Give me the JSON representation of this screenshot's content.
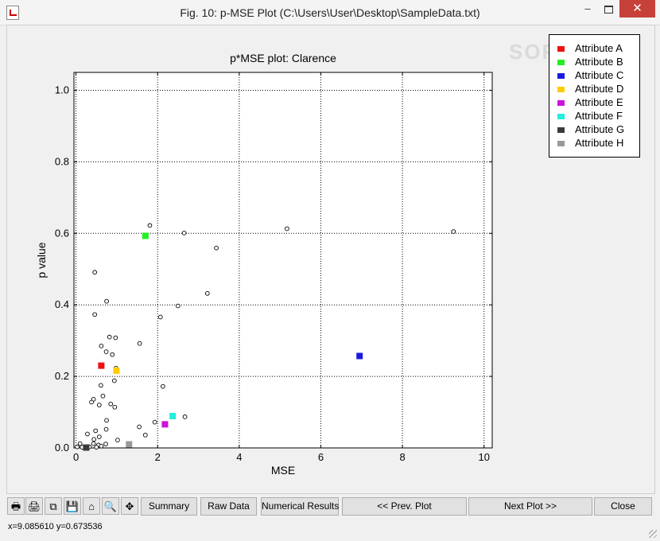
{
  "window": {
    "title": "Fig. 10: p-MSE Plot (C:\\Users\\User\\Desktop\\SampleData.txt)",
    "minimize": "–",
    "close": "✕"
  },
  "watermark": "SOFT",
  "legend": {
    "items": [
      {
        "label": "Attribute A",
        "color": "#ee1111"
      },
      {
        "label": "Attribute B",
        "color": "#22ee22"
      },
      {
        "label": "Attribute C",
        "color": "#1a1adf"
      },
      {
        "label": "Attribute D",
        "color": "#ffcc00"
      },
      {
        "label": "Attribute E",
        "color": "#cc11dd"
      },
      {
        "label": "Attribute F",
        "color": "#22eedd"
      },
      {
        "label": "Attribute G",
        "color": "#3a3a3a"
      },
      {
        "label": "Attribute H",
        "color": "#999999"
      }
    ]
  },
  "chart_data": {
    "type": "scatter",
    "title": "p*MSE plot: Clarence",
    "xlabel": "MSE",
    "ylabel": "p value",
    "xlim": [
      -0.05,
      10.2
    ],
    "ylim": [
      0,
      1.05
    ],
    "xticks": [
      "0",
      "2",
      "4",
      "6",
      "8",
      "10"
    ],
    "yticks": [
      "0.0",
      "0.2",
      "0.4",
      "0.6",
      "0.8",
      "1.0"
    ],
    "xtick_values": [
      0,
      2,
      4,
      6,
      8,
      10
    ],
    "ytick_values": [
      0,
      0.2,
      0.4,
      0.6,
      0.8,
      1.0
    ],
    "grid": true,
    "legend_position": "top-right",
    "highlighted": [
      {
        "name": "Attribute A",
        "x": 0.62,
        "y": 0.23,
        "color": "#ee1111"
      },
      {
        "name": "Attribute B",
        "x": 1.7,
        "y": 0.593,
        "color": "#22ee22"
      },
      {
        "name": "Attribute C",
        "x": 6.95,
        "y": 0.257,
        "color": "#1a1adf"
      },
      {
        "name": "Attribute D",
        "x": 0.99,
        "y": 0.216,
        "color": "#ffcc00"
      },
      {
        "name": "Attribute E",
        "x": 2.18,
        "y": 0.066,
        "color": "#cc11dd"
      },
      {
        "name": "Attribute F",
        "x": 2.37,
        "y": 0.089,
        "color": "#22eedd"
      },
      {
        "name": "Attribute G",
        "x": 0.25,
        "y": 0.001,
        "color": "#3a3a3a"
      },
      {
        "name": "Attribute H",
        "x": 1.3,
        "y": 0.01,
        "color": "#999999"
      }
    ],
    "points": [
      [
        1.81,
        0.622
      ],
      [
        2.65,
        0.601
      ],
      [
        5.17,
        0.613
      ],
      [
        9.25,
        0.605
      ],
      [
        3.44,
        0.559
      ],
      [
        0.46,
        0.491
      ],
      [
        3.22,
        0.432
      ],
      [
        0.75,
        0.41
      ],
      [
        2.5,
        0.397
      ],
      [
        0.46,
        0.373
      ],
      [
        2.07,
        0.366
      ],
      [
        0.82,
        0.31
      ],
      [
        0.97,
        0.308
      ],
      [
        1.56,
        0.292
      ],
      [
        0.62,
        0.285
      ],
      [
        0.74,
        0.269
      ],
      [
        0.89,
        0.261
      ],
      [
        0.98,
        0.223
      ],
      [
        0.94,
        0.188
      ],
      [
        2.13,
        0.172
      ],
      [
        0.61,
        0.175
      ],
      [
        0.66,
        0.145
      ],
      [
        0.43,
        0.136
      ],
      [
        0.38,
        0.128
      ],
      [
        0.57,
        0.12
      ],
      [
        0.85,
        0.123
      ],
      [
        0.95,
        0.114
      ],
      [
        0.75,
        0.077
      ],
      [
        2.67,
        0.087
      ],
      [
        1.93,
        0.072
      ],
      [
        1.55,
        0.059
      ],
      [
        0.48,
        0.048
      ],
      [
        0.74,
        0.052
      ],
      [
        0.28,
        0.039
      ],
      [
        1.7,
        0.036
      ],
      [
        0.57,
        0.031
      ],
      [
        0.44,
        0.024
      ],
      [
        1.02,
        0.022
      ],
      [
        0.1,
        0.012
      ],
      [
        0.43,
        0.012
      ],
      [
        0.55,
        0.008
      ],
      [
        0.73,
        0.011
      ],
      [
        0.62,
        0.005
      ],
      [
        0.33,
        0.003
      ],
      [
        0.03,
        0.003
      ],
      [
        0.5,
        0.002
      ],
      [
        0.15,
        0.002
      ]
    ]
  },
  "toolbar": {
    "icons": [
      {
        "name": "print-icon",
        "glyph": "🖶"
      },
      {
        "name": "print-preview-icon",
        "glyph": "🖨"
      },
      {
        "name": "copy-icon",
        "glyph": "⧉"
      },
      {
        "name": "save-icon",
        "glyph": "💾"
      },
      {
        "name": "home-icon",
        "glyph": "⌂"
      },
      {
        "name": "zoom-icon",
        "glyph": "🔍"
      },
      {
        "name": "pan-icon",
        "glyph": "✥"
      }
    ],
    "summary": "Summary",
    "raw_data": "Raw Data",
    "numerical_results": "Numerical Results",
    "prev_plot": "<< Prev. Plot",
    "next_plot": "Next Plot >>",
    "close": "Close"
  },
  "status": {
    "coordinates": "x=9.085610  y=0.673536"
  }
}
